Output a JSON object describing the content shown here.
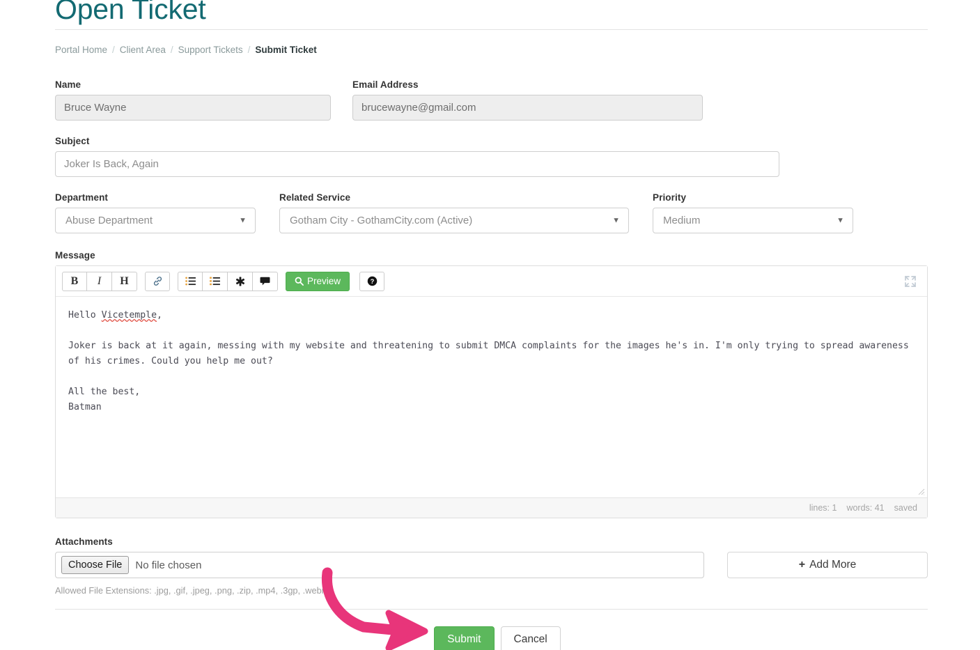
{
  "header": {
    "title": "Open Ticket",
    "breadcrumb": [
      {
        "label": "Portal Home",
        "active": false
      },
      {
        "label": "Client Area",
        "active": false
      },
      {
        "label": "Support Tickets",
        "active": false
      },
      {
        "label": "Submit Ticket",
        "active": true
      }
    ],
    "separator": "/"
  },
  "form": {
    "name": {
      "label": "Name",
      "value": "Bruce Wayne",
      "disabled": true
    },
    "email": {
      "label": "Email Address",
      "value": "brucewayne@gmail.com",
      "disabled": true
    },
    "subject": {
      "label": "Subject",
      "value": "Joker Is Back, Again",
      "placeholder": "Joker Is Back, Again"
    },
    "department": {
      "label": "Department",
      "value": "Abuse Department",
      "options": [
        "Abuse Department"
      ]
    },
    "related_service": {
      "label": "Related Service",
      "value": "Gotham City - GothamCity.com (Active)",
      "options": [
        "Gotham City - GothamCity.com (Active)"
      ]
    },
    "priority": {
      "label": "Priority",
      "value": "Medium",
      "options": [
        "Medium"
      ]
    }
  },
  "editor": {
    "label": "Message",
    "toolbar": {
      "bold": "B",
      "italic": "I",
      "heading": "H",
      "link_icon": "link-icon",
      "unordered_list_icon": "unordered-list-icon",
      "ordered_list_icon": "ordered-list-icon",
      "asterisk_icon": "asterisk-icon",
      "quote_icon": "comment-quote-icon",
      "preview_label": "Preview",
      "preview_icon": "search-icon",
      "help_icon": "question-circle-icon",
      "fullscreen_icon": "fullscreen-expand-icon"
    },
    "message": {
      "line1_pre": "Hello ",
      "line1_misspelled": "Vicetemple",
      "line1_post": ",",
      "paragraph": "Joker is back at it again, messing with my website and threatening to submit DMCA complaints for the images he's in. I'm only trying to spread awareness of his crimes. Could you help me out?",
      "signoff": "All the best,",
      "signature": "Batman"
    },
    "status": {
      "lines": "lines: 1",
      "words": "words: 41",
      "saved": "saved"
    }
  },
  "attachments": {
    "label": "Attachments",
    "choose_file_label": "Choose File",
    "file_name": "No file chosen",
    "add_more_label": "Add More",
    "add_more_plus": "+",
    "allowed": "Allowed File Extensions: .jpg, .gif, .jpeg, .png, .zip, .mp4, .3gp, .webm"
  },
  "actions": {
    "submit_label": "Submit",
    "cancel_label": "Cancel"
  },
  "annotation": {
    "arrow_color": "#e8357a",
    "arrow_target": "submit-button"
  },
  "colors": {
    "title": "#136a72",
    "primary_green": "#5cb85c",
    "annotation_pink": "#e8357a",
    "muted_text": "#9d9d9d"
  }
}
